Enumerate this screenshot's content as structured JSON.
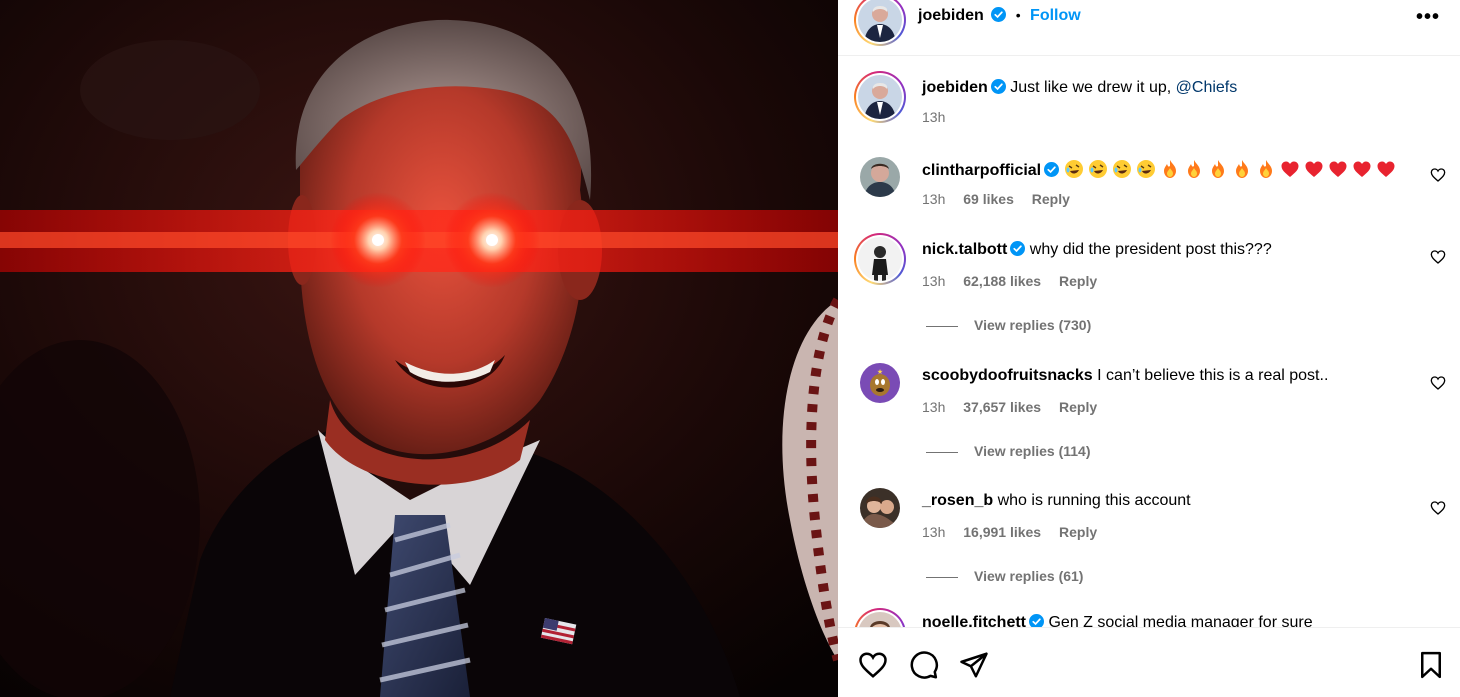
{
  "post": {
    "author": "joebiden",
    "follow_label": "Follow",
    "separator": "•",
    "more_label": "•••",
    "caption_text": "Just like we drew it up,",
    "caption_mention": "@Chiefs",
    "caption_time": "13h"
  },
  "comments": [
    {
      "user": "clintharpofficial",
      "verified": true,
      "emojis": [
        "rofl",
        "rofl",
        "rofl",
        "rofl",
        "fire",
        "fire",
        "fire",
        "fire",
        "fire",
        "heart",
        "heart",
        "heart",
        "heart",
        "heart"
      ],
      "text": "",
      "time": "13h",
      "likes": "69 likes",
      "reply": "Reply"
    },
    {
      "user": "nick.talbott",
      "verified": true,
      "text": "why did the president post this???",
      "time": "13h",
      "likes": "62,188 likes",
      "reply": "Reply",
      "view_replies": "View replies (730)"
    },
    {
      "user": "scoobydoofruitsnacks",
      "verified": false,
      "text": "I can’t believe this is a real post..",
      "time": "13h",
      "likes": "37,657 likes",
      "reply": "Reply",
      "view_replies": "View replies (114)"
    },
    {
      "user": "_rosen_b",
      "verified": false,
      "text": "who is running this account",
      "time": "13h",
      "likes": "16,991 likes",
      "reply": "Reply",
      "view_replies": "View replies (61)"
    },
    {
      "user": "noelle.fitchett",
      "verified": true,
      "text": "Gen Z social media manager for sure",
      "time": "",
      "likes": "",
      "reply": ""
    }
  ],
  "icons": {
    "like": "heart-icon",
    "comment": "comment-icon",
    "share": "share-icon",
    "save": "bookmark-icon",
    "verified": "verified-badge-icon",
    "more": "more-options-icon"
  },
  "colors": {
    "follow": "#0095f6",
    "mention": "#00376b",
    "muted": "#737373",
    "verified": "#0095f6",
    "laser": "#ff1a1a"
  }
}
